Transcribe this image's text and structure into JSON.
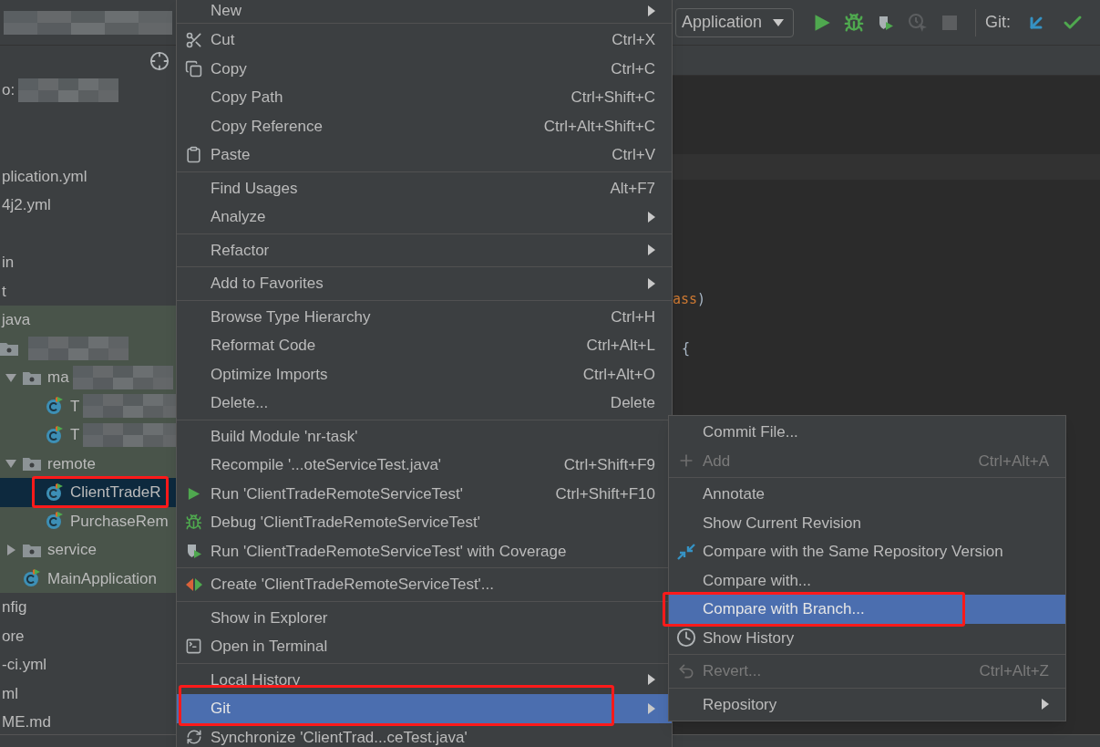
{
  "sidebar": {
    "header": {
      "redacted": true
    },
    "tree": [
      {
        "kind": "file",
        "label": "o:",
        "redacted": true
      },
      {
        "kind": "blank"
      },
      {
        "kind": "blank"
      },
      {
        "kind": "file",
        "label": "plication.yml"
      },
      {
        "kind": "file",
        "label": "4j2.yml"
      },
      {
        "kind": "blank"
      },
      {
        "kind": "file",
        "label": "in"
      },
      {
        "kind": "file",
        "label": "t"
      },
      {
        "kind": "file",
        "label": "java",
        "test_scope": true,
        "children": [
          {
            "kind": "package",
            "redacted": true,
            "children": [
              {
                "kind": "folder",
                "label": "ma",
                "expanded": true,
                "redacted": true,
                "children": [
                  {
                    "kind": "class",
                    "label": "T",
                    "selected": false,
                    "redacted": true
                  },
                  {
                    "kind": "class",
                    "label": "T",
                    "selected": false,
                    "redacted": true
                  }
                ]
              },
              {
                "kind": "folder",
                "label": "remote",
                "expanded": true,
                "children": [
                  {
                    "kind": "class",
                    "label": "ClientTradeR",
                    "selected": true,
                    "highlighted": true
                  },
                  {
                    "kind": "class",
                    "label": "PurchaseRem",
                    "selected": false
                  }
                ]
              },
              {
                "kind": "folder",
                "label": "service",
                "expanded": false
              },
              {
                "kind": "class",
                "label": "MainApplication",
                "selected": false
              }
            ]
          }
        ]
      },
      {
        "kind": "file",
        "label": "nfig"
      },
      {
        "kind": "file",
        "label": "ore"
      },
      {
        "kind": "file",
        "label": "-ci.yml"
      },
      {
        "kind": "file",
        "label": "ml"
      },
      {
        "kind": "file",
        "label": "ME.md"
      }
    ]
  },
  "toolbar": {
    "run_config": "Application",
    "buttons": [
      {
        "kind": "run",
        "disabled": false
      },
      {
        "kind": "debug",
        "disabled": false
      },
      {
        "kind": "coverage",
        "disabled": false
      },
      {
        "kind": "profile",
        "disabled": true
      },
      {
        "kind": "stop",
        "disabled": true
      }
    ],
    "git_label": "Git:",
    "git_buttons": [
      {
        "kind": "update"
      },
      {
        "kind": "commit"
      }
    ]
  },
  "editor": {
    "lines": [
      {
        "tokens": [
          {
            "kind": "keyword",
            "text": "ass"
          },
          {
            "kind": "plain",
            "text": ")"
          }
        ]
      },
      {
        "tokens": [
          {
            "kind": "plain",
            "text": "{"
          }
        ]
      }
    ]
  },
  "context_menu": {
    "groups": [
      {
        "items": [
          {
            "kind": "plain",
            "label": "New",
            "submenu": true,
            "selected": false
          }
        ]
      },
      {
        "items": [
          {
            "kind": "cut",
            "label": "Cut",
            "shortcut": "Ctrl+X",
            "selected": false
          },
          {
            "kind": "copy",
            "label": "Copy",
            "shortcut": "Ctrl+C",
            "selected": false
          },
          {
            "kind": "plain",
            "label": "Copy Path",
            "shortcut": "Ctrl+Shift+C",
            "selected": false
          },
          {
            "kind": "plain",
            "label": "Copy Reference",
            "shortcut": "Ctrl+Alt+Shift+C",
            "selected": false
          },
          {
            "kind": "paste",
            "label": "Paste",
            "shortcut": "Ctrl+V",
            "selected": false
          }
        ]
      },
      {
        "items": [
          {
            "kind": "plain",
            "label": "Find Usages",
            "shortcut": "Alt+F7",
            "selected": false
          },
          {
            "kind": "plain",
            "label": "Analyze",
            "submenu": true,
            "selected": false
          }
        ]
      },
      {
        "items": [
          {
            "kind": "plain",
            "label": "Refactor",
            "submenu": true,
            "selected": false
          }
        ]
      },
      {
        "items": [
          {
            "kind": "plain",
            "label": "Add to Favorites",
            "submenu": true,
            "selected": false
          }
        ]
      },
      {
        "items": [
          {
            "kind": "plain",
            "label": "Browse Type Hierarchy",
            "shortcut": "Ctrl+H",
            "selected": false
          },
          {
            "kind": "plain",
            "label": "Reformat Code",
            "shortcut": "Ctrl+Alt+L",
            "selected": false
          },
          {
            "kind": "plain",
            "label": "Optimize Imports",
            "shortcut": "Ctrl+Alt+O",
            "selected": false
          },
          {
            "kind": "plain",
            "label": "Delete...",
            "shortcut": "Delete",
            "selected": false
          }
        ]
      },
      {
        "items": [
          {
            "kind": "plain",
            "label": "Build Module 'nr-task'",
            "selected": false
          },
          {
            "kind": "plain",
            "label": "Recompile '...oteServiceTest.java'",
            "shortcut": "Ctrl+Shift+F9",
            "selected": false
          },
          {
            "kind": "run",
            "label": "Run 'ClientTradeRemoteServiceTest'",
            "shortcut": "Ctrl+Shift+F10",
            "selected": false
          },
          {
            "kind": "debug",
            "label": "Debug 'ClientTradeRemoteServiceTest'",
            "selected": false
          },
          {
            "kind": "coverage",
            "label": "Run 'ClientTradeRemoteServiceTest' with Coverage",
            "selected": false
          }
        ]
      },
      {
        "items": [
          {
            "kind": "create",
            "label": "Create 'ClientTradeRemoteServiceTest'...",
            "selected": false
          }
        ]
      },
      {
        "items": [
          {
            "kind": "plain",
            "label": "Show in Explorer",
            "selected": false
          },
          {
            "kind": "terminal",
            "label": "Open in Terminal",
            "selected": false
          }
        ]
      },
      {
        "items": [
          {
            "kind": "plain",
            "label": "Local History",
            "submenu": true,
            "selected": false
          },
          {
            "kind": "plain",
            "label": "Git",
            "submenu": true,
            "selected": true,
            "highlighted": true
          },
          {
            "kind": "sync",
            "label": "Synchronize 'ClientTrad...ceTest.java'",
            "selected": false
          }
        ]
      }
    ]
  },
  "git_submenu": {
    "groups": [
      {
        "items": [
          {
            "kind": "plain",
            "label": "Commit File...",
            "selected": false,
            "disabled": false
          },
          {
            "kind": "add",
            "label": "Add",
            "shortcut": "Ctrl+Alt+A",
            "selected": false,
            "disabled": true
          }
        ]
      },
      {
        "items": [
          {
            "kind": "plain",
            "label": "Annotate",
            "selected": false,
            "disabled": false
          },
          {
            "kind": "plain",
            "label": "Show Current Revision",
            "selected": false,
            "disabled": false
          },
          {
            "kind": "compare",
            "label": "Compare with the Same Repository Version",
            "selected": false,
            "disabled": false
          },
          {
            "kind": "plain",
            "label": "Compare with...",
            "selected": false,
            "disabled": false
          },
          {
            "kind": "plain",
            "label": "Compare with Branch...",
            "selected": true,
            "highlighted": true,
            "disabled": false
          },
          {
            "kind": "history",
            "label": "Show History",
            "selected": false,
            "disabled": false
          }
        ]
      },
      {
        "items": [
          {
            "kind": "revert",
            "label": "Revert...",
            "shortcut": "Ctrl+Alt+Z",
            "selected": false,
            "disabled": true
          }
        ]
      },
      {
        "items": [
          {
            "kind": "plain",
            "label": "Repository",
            "submenu": true,
            "selected": false,
            "disabled": false
          }
        ]
      }
    ]
  }
}
